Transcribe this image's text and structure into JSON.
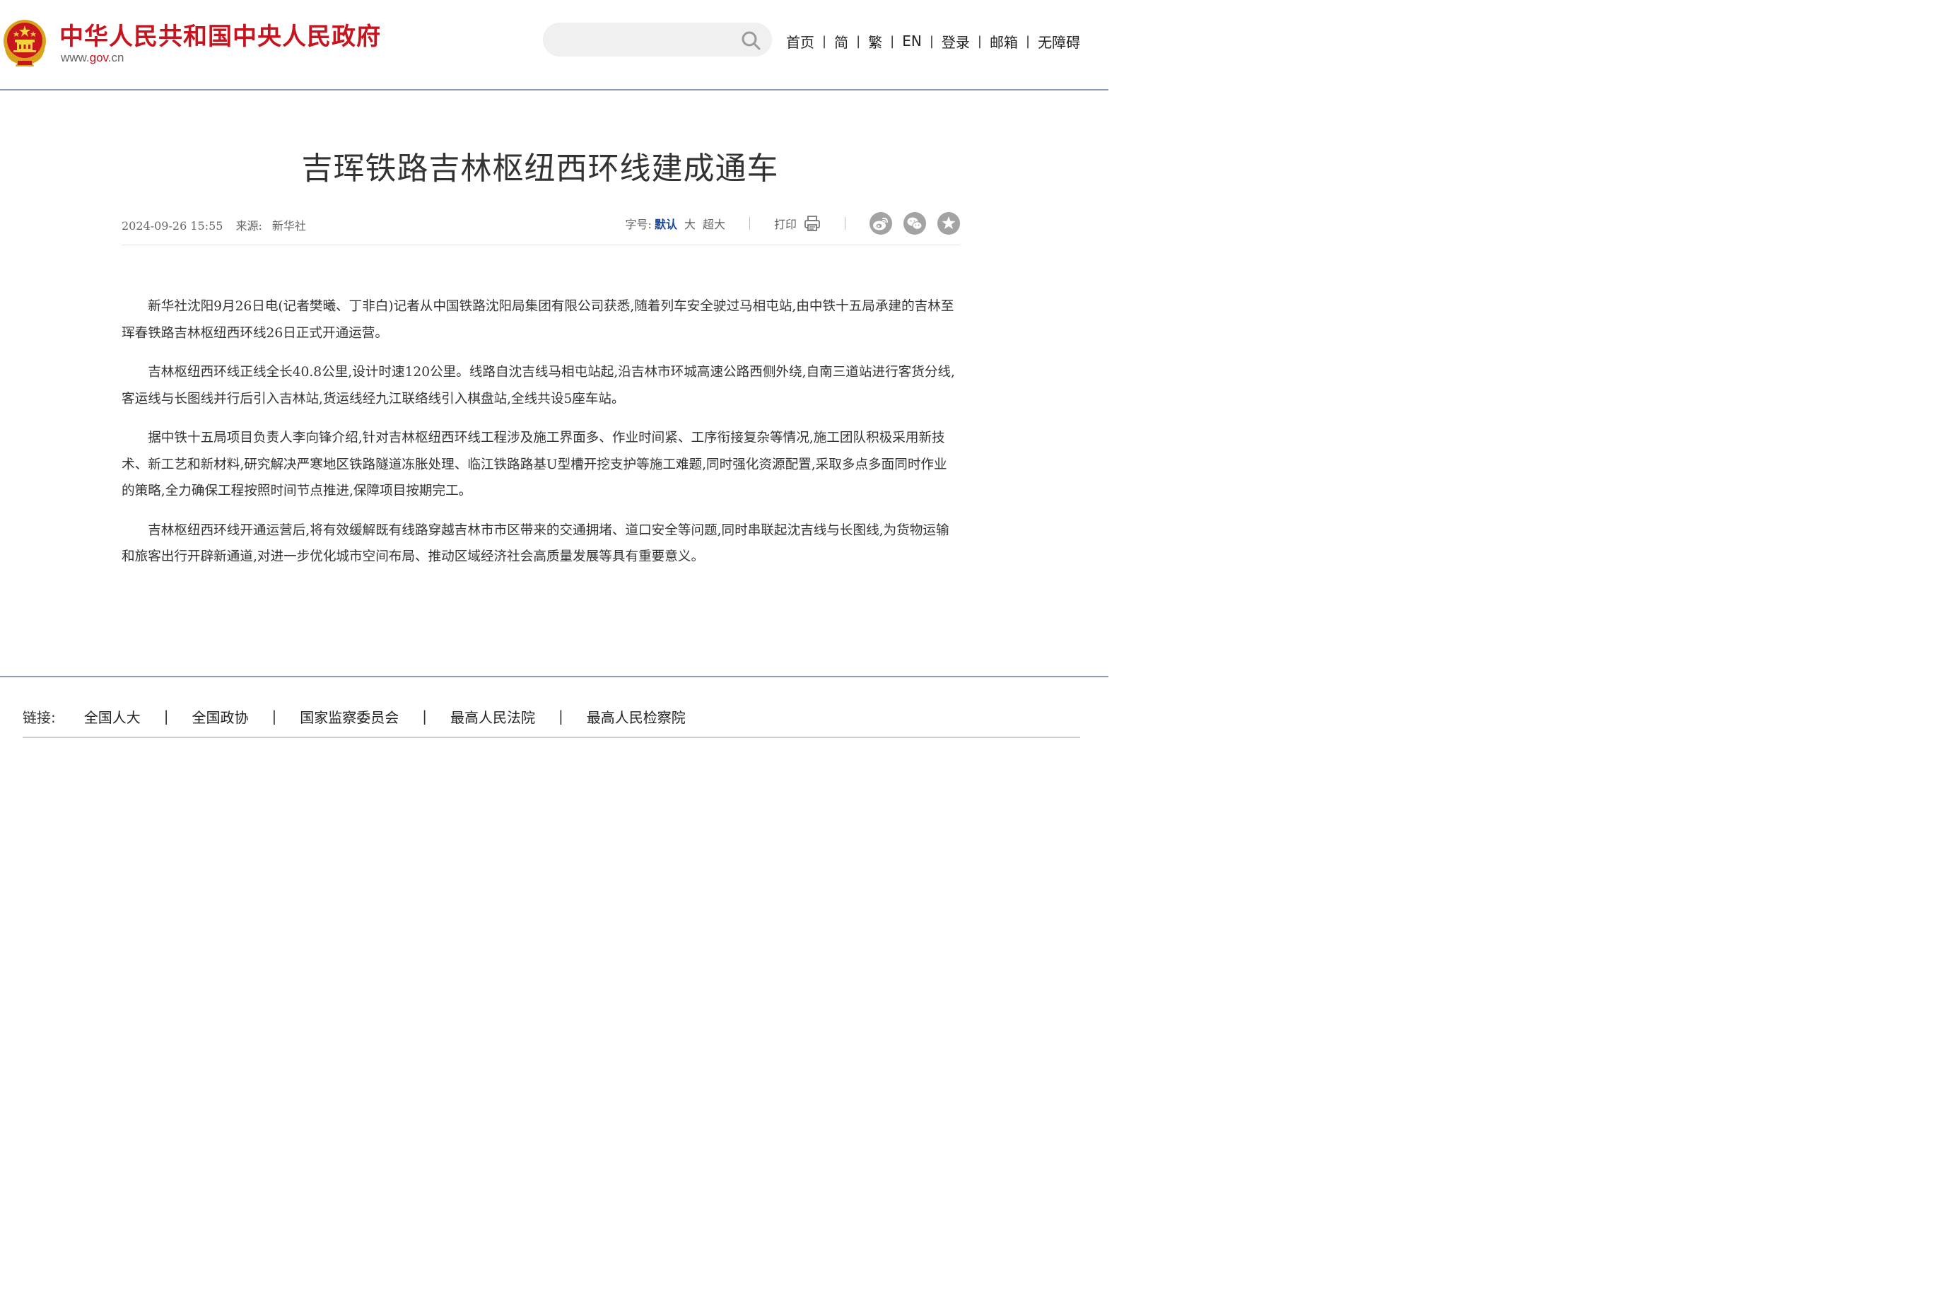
{
  "header": {
    "site_title": "中华人民共和国中央人民政府",
    "url_prefix": "www.",
    "url_mid": "gov",
    "url_suffix": ".cn",
    "search": {
      "placeholder": "",
      "value": ""
    },
    "nav": [
      {
        "label": "首页"
      },
      {
        "label": "简"
      },
      {
        "label": "繁"
      },
      {
        "label": "EN"
      },
      {
        "label": "登录"
      },
      {
        "label": "邮箱"
      },
      {
        "label": "无障碍"
      }
    ],
    "nav_sep": "|"
  },
  "article": {
    "title": "吉珲铁路吉林枢纽西环线建成通车",
    "date": "2024-09-26 15:55",
    "source_label": "来源:",
    "source": "新华社",
    "font_size_label": "字号:",
    "font_sizes": [
      "默认",
      "大",
      "超大"
    ],
    "print_label": "打印",
    "paragraphs": [
      "新华社沈阳9月26日电(记者樊曦、丁非白)记者从中国铁路沈阳局集团有限公司获悉,随着列车安全驶过马相屯站,由中铁十五局承建的吉林至珲春铁路吉林枢纽西环线26日正式开通运营。",
      "吉林枢纽西环线正线全长40.8公里,设计时速120公里。线路自沈吉线马相屯站起,沿吉林市环城高速公路西侧外绕,自南三道站进行客货分线,客运线与长图线并行后引入吉林站,货运线经九江联络线引入棋盘站,全线共设5座车站。",
      "据中铁十五局项目负责人李向锋介绍,针对吉林枢纽西环线工程涉及施工界面多、作业时间紧、工序衔接复杂等情况,施工团队积极采用新技术、新工艺和新材料,研究解决严寒地区铁路隧道冻胀处理、临江铁路路基U型槽开挖支护等施工难题,同时强化资源配置,采取多点多面同时作业的策略,全力确保工程按照时间节点推进,保障项目按期完工。",
      "吉林枢纽西环线开通运营后,将有效缓解既有线路穿越吉林市市区带来的交通拥堵、道口安全等问题,同时串联起沈吉线与长图线,为货物运输和旅客出行开辟新通道,对进一步优化城市空间布局、推动区域经济社会高质量发展等具有重要意义。"
    ]
  },
  "footer": {
    "links_label": "链接:",
    "links": [
      "全国人大",
      "全国政协",
      "国家监察委员会",
      "最高人民法院",
      "最高人民检察院"
    ],
    "sep": "|"
  },
  "colors": {
    "brand_red": "#c6151e",
    "link_blue": "#1b4aa0",
    "divider": "#8c9cb4",
    "share_gray": "#a3a3a3"
  },
  "icons": [
    "national-emblem-icon",
    "search-icon",
    "printer-icon",
    "weibo-icon",
    "wechat-icon",
    "favorite-star-icon"
  ]
}
